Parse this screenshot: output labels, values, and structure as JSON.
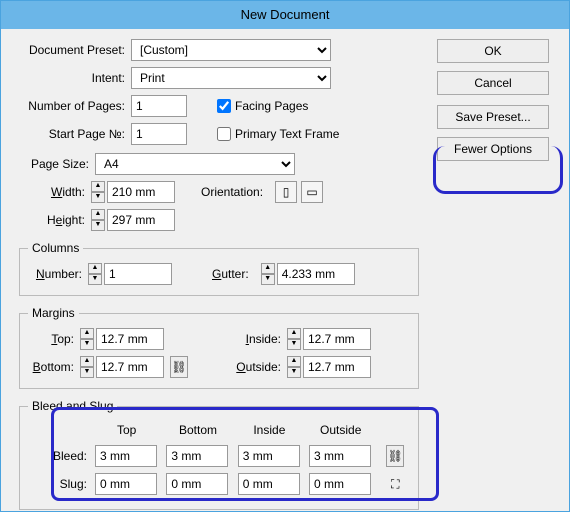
{
  "title": "New Document",
  "buttons": {
    "ok": "OK",
    "cancel": "Cancel",
    "save_preset": "Save Preset...",
    "fewer_options": "Fewer Options"
  },
  "labels": {
    "doc_preset": "Document Preset:",
    "intent": "Intent:",
    "num_pages": "Number of Pages:",
    "start_page": "Start Page №:",
    "facing_pages": "Facing Pages",
    "primary_text": "Primary Text Frame",
    "page_size": "Page Size:",
    "width": "Width:",
    "height": "Height:",
    "orientation": "Orientation:",
    "columns": "Columns",
    "number": "Number:",
    "gutter": "Gutter:",
    "margins": "Margins",
    "top": "Top:",
    "bottom": "Bottom:",
    "inside": "Inside:",
    "outside": "Outside:",
    "bleed_slug": "Bleed and Slug",
    "bleed": "Bleed:",
    "slug": "Slug:",
    "col_top": "Top",
    "col_bottom": "Bottom",
    "col_inside": "Inside",
    "col_outside": "Outside"
  },
  "values": {
    "doc_preset": "[Custom]",
    "intent": "Print",
    "num_pages": "1",
    "start_page": "1",
    "facing_pages": true,
    "primary_text": false,
    "page_size": "A4",
    "width": "210 mm",
    "height": "297 mm",
    "col_number": "1",
    "gutter": "4.233 mm",
    "m_top": "12.7 mm",
    "m_bottom": "12.7 mm",
    "m_inside": "12.7 mm",
    "m_outside": "12.7 mm",
    "bleed_top": "3 mm",
    "bleed_bottom": "3 mm",
    "bleed_inside": "3 mm",
    "bleed_outside": "3 mm",
    "slug_top": "0 mm",
    "slug_bottom": "0 mm",
    "slug_inside": "0 mm",
    "slug_outside": "0 mm"
  }
}
